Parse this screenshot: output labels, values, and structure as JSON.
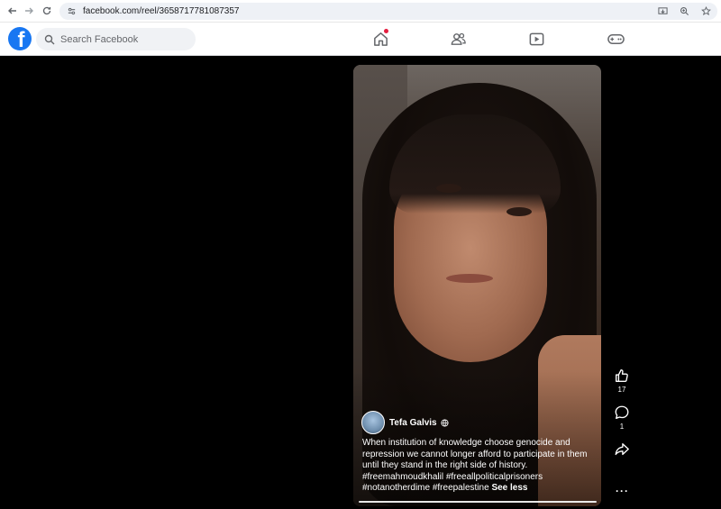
{
  "browser": {
    "url": "facebook.com/reel/3658717781087357"
  },
  "header": {
    "logo_letter": "f",
    "search_placeholder": "Search Facebook",
    "nav_icons": [
      "home-icon",
      "friends-icon",
      "video-icon",
      "gaming-icon"
    ]
  },
  "reel": {
    "author": "Tefa Galvis",
    "caption": "When institution of knowledge choose genocide and repression we cannot longer afford to participate in them until they stand in the right side of history. #freemahmoudkhalil #freeallpoliticalprisoners #notanotherdime #freepalestine",
    "see_less": "See less",
    "likes": "17",
    "comments": "1",
    "more": "···"
  },
  "colors": {
    "brand": "#1877f2",
    "notification": "#e41e3f"
  }
}
